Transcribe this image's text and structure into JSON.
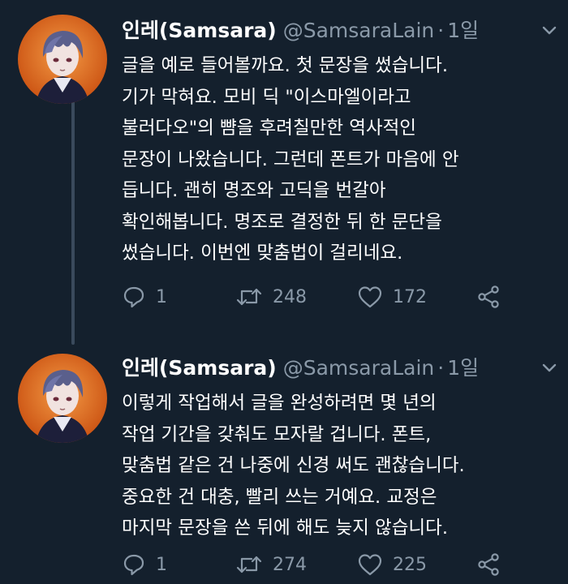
{
  "tweets": [
    {
      "display_name": "인레(Samsara)",
      "handle": "@SamsaraLain",
      "separator": "·",
      "time": "1일",
      "menu_icon": "chevron-down-icon",
      "lines": [
        "글을 예로 들어볼까요. 첫 문장을 썼습니다.",
        "기가 막혀요. 모비 딕 \"이스마엘이라고",
        "불러다오\"의 뺨을 후려칠만한 역사적인",
        "문장이 나왔습니다. 그런데 폰트가 마음에 안",
        "듭니다. 괜히 명조와 고딕을 번갈아",
        "확인해봅니다. 명조로 결정한 뒤 한 문단을",
        "썼습니다. 이번엔 맞춤법이 걸리네요."
      ],
      "replies": "1",
      "retweets": "248",
      "likes": "172"
    },
    {
      "display_name": "인레(Samsara)",
      "handle": "@SamsaraLain",
      "separator": "·",
      "time": "1일",
      "menu_icon": "chevron-down-icon",
      "lines": [
        "이렇게 작업해서 글을 완성하려면 몇 년의",
        "작업 기간을 갖춰도 모자랄 겁니다. 폰트,",
        "맞춤법 같은 건 나중에 신경 써도 괜찮습니다.",
        "중요한 건 대충, 빨리 쓰는 거예요. 교정은",
        "마지막 문장을 쓴 뒤에 해도 늦지 않습니다."
      ],
      "replies": "1",
      "retweets": "274",
      "likes": "225"
    }
  ],
  "colors": {
    "background": "#14202d",
    "text": "#ffffff",
    "muted": "#8a99a8",
    "thread_line": "#3a4a5c",
    "avatar_bg": "#e5671d"
  },
  "icons": {
    "reply": "reply-icon",
    "retweet": "retweet-icon",
    "like": "heart-icon",
    "share": "share-icon"
  }
}
